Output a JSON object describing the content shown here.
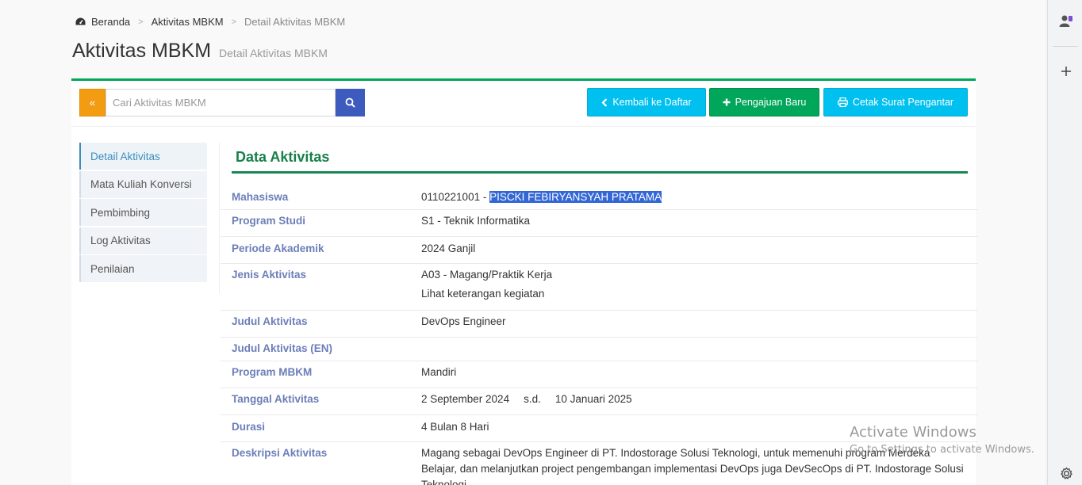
{
  "breadcrumb": {
    "home": "Beranda",
    "parent": "Aktivitas MBKM",
    "current": "Detail Aktivitas MBKM"
  },
  "page": {
    "title": "Aktivitas MBKM",
    "subtitle": "Detail Aktivitas MBKM"
  },
  "toolbar": {
    "back_icon": "«",
    "search_placeholder": "Cari Aktivitas MBKM",
    "kembali_label": "Kembali ke Daftar",
    "pengajuan_label": "Pengajuan Baru",
    "cetak_label": "Cetak Surat Pengantar"
  },
  "sidenav": {
    "items": [
      {
        "label": "Detail Aktivitas"
      },
      {
        "label": "Mata Kuliah Konversi"
      },
      {
        "label": "Pembimbing"
      },
      {
        "label": "Log Aktivitas"
      },
      {
        "label": "Penilaian"
      }
    ]
  },
  "section": {
    "title": "Data Aktivitas"
  },
  "fields": {
    "mahasiswa": {
      "label": "Mahasiswa",
      "nim": "0110221001 - ",
      "name": "PISCKI FEBIRYANSYAH PRATAMA"
    },
    "prodi": {
      "label": "Program Studi",
      "value": "S1 - Teknik Informatika"
    },
    "periode": {
      "label": "Periode Akademik",
      "value": "2024 Ganjil"
    },
    "jenis": {
      "label": "Jenis Aktivitas",
      "value": "A03 - Magang/Praktik Kerja",
      "link": "Lihat keterangan kegiatan"
    },
    "judul": {
      "label": "Judul Aktivitas",
      "value": "DevOps Engineer"
    },
    "judul_en": {
      "label": "Judul Aktivitas (EN)",
      "value": ""
    },
    "program": {
      "label": "Program MBKM",
      "value": "Mandiri"
    },
    "tanggal": {
      "label": "Tanggal Aktivitas",
      "start": "2 September 2024",
      "sd": "s.d.",
      "end": "10 Januari 2025"
    },
    "durasi": {
      "label": "Durasi",
      "value": "4 Bulan 8 Hari"
    },
    "deskripsi": {
      "label": "Deskripsi Aktivitas",
      "value": "Magang sebagai DevOps Engineer di PT. Indostorage Solusi Teknologi, untuk memenuhi program Merdeka Belajar, dan melanjutkan project pengembangan implementasi DevOps juga DevSecOps di PT. Indostorage Solusi Teknologi"
    }
  },
  "watermark": {
    "line1": "Activate Windows",
    "line2": "Go to Settings to activate Windows."
  },
  "icons": {
    "home": "dashboard-icon",
    "back": "chevron-left-icon",
    "add": "plus-icon",
    "print": "print-icon",
    "search": "search-icon",
    "settings": "gear-icon",
    "profile": "profile-icon"
  },
  "colors": {
    "success": "#00a65a",
    "info": "#00c0ef",
    "warning": "#f39c12",
    "primary": "#3c5bbd",
    "label": "#6b7eb8"
  }
}
